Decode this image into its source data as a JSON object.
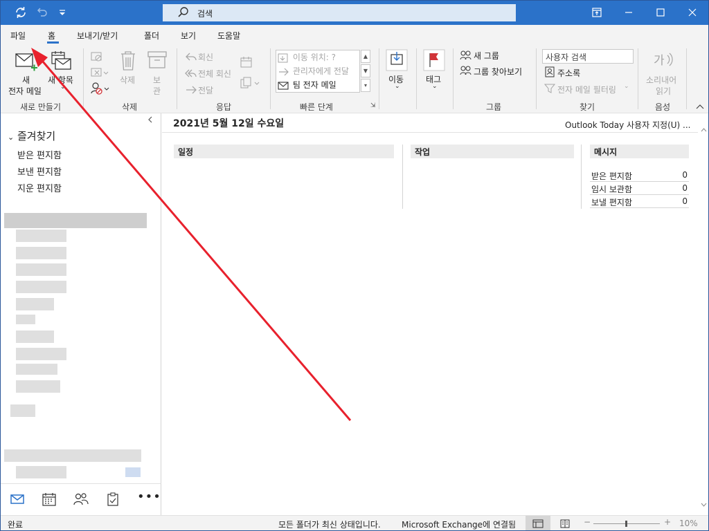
{
  "titlebar": {
    "search_placeholder": "검색",
    "icons": [
      "sync-icon",
      "undo-icon",
      "customize-quick-access-icon",
      "ribbon-display-options-icon",
      "minimize-icon",
      "maximize-icon",
      "close-icon"
    ]
  },
  "menu": {
    "tabs": [
      "파일",
      "홈",
      "보내기/받기",
      "폴더",
      "보기",
      "도움말"
    ],
    "active": "홈"
  },
  "ribbon": {
    "new": {
      "new_mail_line1": "새",
      "new_mail_line2": "전자 메일",
      "new_items": "새 항목",
      "group": "새로 만들기"
    },
    "delete": {
      "delete": "삭제",
      "archive_line1": "보",
      "archive_line2": "관",
      "group": "삭제"
    },
    "respond": {
      "reply": "회신",
      "reply_all": "전체 회신",
      "forward": "전달",
      "group": "응답"
    },
    "quick_steps": {
      "move_to": "이동 위치: ?",
      "to_manager": "관리자에게 전달",
      "team_email": "팀 전자 메일",
      "group": "빠른 단계"
    },
    "move": {
      "label": "이동"
    },
    "tags": {
      "label": "태그"
    },
    "groups": {
      "new_group": "새 그룹",
      "browse_groups": "그룹 찾아보기",
      "group": "그룹"
    },
    "find": {
      "search_people": "사용자 검색",
      "address_book": "주소록",
      "filter_email": "전자 메일 필터링",
      "group": "찾기"
    },
    "speech": {
      "read_aloud_line1": "소리내어",
      "read_aloud_line2": "읽기",
      "group": "음성"
    }
  },
  "folders": {
    "favorites_label": "즐겨찾기",
    "favorites": [
      "받은 편지함",
      "보낸 편지함",
      "지운 편지함"
    ]
  },
  "outlook_today": {
    "date": "2021년 5월 12일 수요일",
    "customize": "Outlook Today 사용자 지정(U) ...",
    "calendar_head": "일정",
    "tasks_head": "작업",
    "messages_head": "메시지",
    "messages": [
      {
        "label": "받은 편지함",
        "count": "0"
      },
      {
        "label": "임시 보관함",
        "count": "0"
      },
      {
        "label": "보낼 편지함",
        "count": "0"
      }
    ]
  },
  "navbar": {
    "icons": [
      "mail-icon",
      "calendar-icon",
      "people-icon",
      "tasks-icon",
      "more-icon"
    ]
  },
  "status": {
    "left": "완료",
    "folders_status": "모든 폴더가 최신 상태입니다.",
    "connection": "Microsoft Exchange에 연결됨",
    "zoom": "10%"
  },
  "colors": {
    "titlebar": "#2b72c9",
    "annotation_arrow": "#e8212d",
    "tag_flag": "#d13438"
  }
}
